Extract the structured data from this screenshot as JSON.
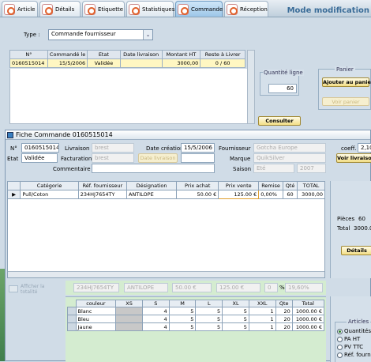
{
  "tabs": [
    {
      "label": "Article",
      "icon": "article-icon"
    },
    {
      "label": "Détails",
      "icon": "details-icon"
    },
    {
      "label": "Etiquette",
      "icon": "label-icon"
    },
    {
      "label": "Statistiques",
      "icon": "stats-icon"
    },
    {
      "label": "Commande",
      "icon": "order-icon"
    },
    {
      "label": "Réception",
      "icon": "reception-icon"
    }
  ],
  "mode_title": "Mode modification",
  "type_label": "Type :",
  "type_value": "Commande fournisseur",
  "order_table": {
    "headers": [
      "N°",
      "Commandé le",
      "Etat",
      "Date livraison",
      "Montant HT",
      "Reste à Livrer"
    ],
    "rows": [
      [
        "0160515014",
        "15/5/2006",
        "Validée",
        "",
        "3000,00",
        "0 / 60"
      ]
    ]
  },
  "quantite_ligne_label": "Quantité ligne",
  "quantite_ligne_value": "60",
  "consulter_label": "Consulter",
  "panier": {
    "title": "Panier",
    "add_label": "Ajouter au panier",
    "view_label": "Voir panier"
  },
  "fiche": {
    "title": "Fiche Commande 0160515014",
    "num_label": "N°",
    "num_value": "0160515014",
    "livraison_label": "Livraison",
    "livraison_value": "brest",
    "date_creation_label": "Date création",
    "date_creation_value": "15/5/2006",
    "fournisseur_label": "Fournisseur",
    "fournisseur_value": "Gotcha Europe",
    "coeff_label": "coeff.",
    "coeff_value": "2,10",
    "etat_label": "Etat",
    "etat_value": "Validée",
    "facturation_label": "Facturation",
    "facturation_value": "brest",
    "date_livraison_btn": "Date livraison",
    "marque_label": "Marque",
    "marque_value": "QuikSilver",
    "voir_livraison_label": "Voir livraison",
    "commentaire_label": "Commentaire",
    "saison_label": "Saison",
    "saison_value": "Eté",
    "annee_value": "2007"
  },
  "lines_table": {
    "headers": [
      "Catégorie",
      "Réf. fournisseur",
      "Désignation",
      "Prix achat",
      "Prix vente",
      "Remise",
      "Qté",
      "TOTAL"
    ],
    "rows": [
      [
        "Pull/Coton",
        "234HJ7654TY",
        "ANTILOPE",
        "50.00 €",
        "125.00 €",
        "0,00%",
        "60",
        "3000,00"
      ]
    ]
  },
  "summary": {
    "pieces_label": "Pièces",
    "pieces_value": "60",
    "total_label": "Total",
    "total_value": "3000.0",
    "details_label": "Détails"
  },
  "edit_row": {
    "checkbox_label": "Afficher la totalité",
    "ref": "234HJ7654TY",
    "designation": "ANTILOPE",
    "prix_achat": "50.00 €",
    "prix_vente": "125.00 €",
    "remise": "0",
    "pct": "%",
    "total_pct": "19,60%"
  },
  "sizes_table": {
    "headers": [
      "couleur",
      "XS",
      "S",
      "M",
      "L",
      "XL",
      "XXL",
      "Qte",
      "Total"
    ],
    "rows": [
      [
        "Blanc",
        "",
        "4",
        "5",
        "5",
        "5",
        "1",
        "20",
        "1000.00 €"
      ],
      [
        "Bleu",
        "",
        "4",
        "5",
        "5",
        "5",
        "1",
        "20",
        "1000.00 €"
      ],
      [
        "Jaune",
        "",
        "4",
        "5",
        "5",
        "5",
        "1",
        "20",
        "1000.00 €"
      ]
    ]
  },
  "articles": {
    "title": "Articles",
    "options": [
      "Quantités",
      "PA HT",
      "PV TTC",
      "Réf. fourn."
    ]
  },
  "colors": {
    "accent": "#3a6c98",
    "row_selected": "#fff7c2",
    "button": "#f2dd86"
  }
}
